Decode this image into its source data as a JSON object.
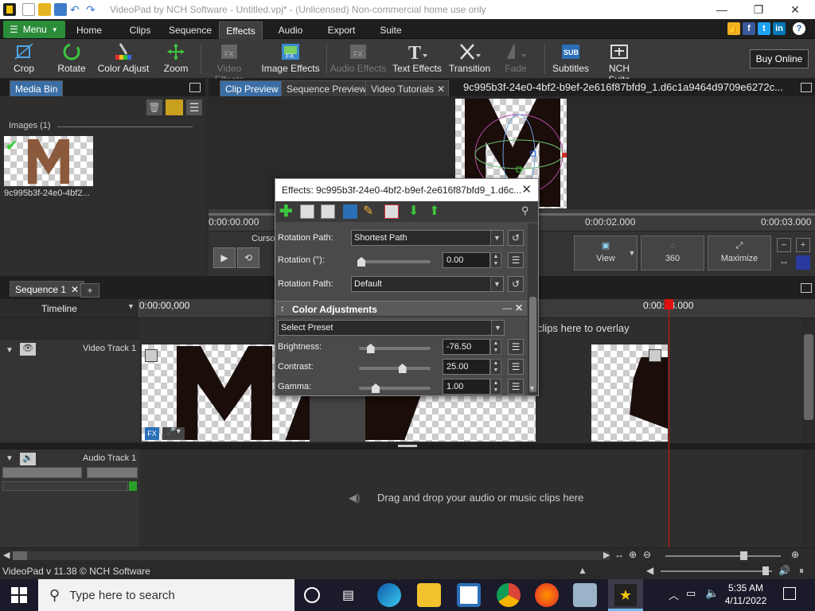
{
  "app": {
    "window_title": "VideoPad by NCH Software - Untitled.vpj* - (Unlicensed) Non-commercial home use only"
  },
  "ribbon": {
    "menu_label": "Menu",
    "tabs": [
      "Home",
      "Clips",
      "Sequence",
      "Effects",
      "Audio",
      "Export",
      "Suite"
    ],
    "active_tab": "Effects"
  },
  "toolbar": {
    "tools": [
      {
        "label": "Crop",
        "icon": "crop-icon",
        "enabled": true
      },
      {
        "label": "Rotate",
        "icon": "rotate-icon",
        "enabled": true
      },
      {
        "label": "Color Adjust",
        "icon": "color-adjust-icon",
        "enabled": true
      },
      {
        "label": "Zoom",
        "icon": "zoom-icon",
        "enabled": true
      },
      {
        "label": "Video Effects",
        "icon": "video-effects-icon",
        "enabled": false
      },
      {
        "label": "Image Effects",
        "icon": "image-effects-icon",
        "enabled": true
      },
      {
        "label": "Audio Effects",
        "icon": "audio-effects-icon",
        "enabled": false
      },
      {
        "label": "Text Effects",
        "icon": "text-effects-icon",
        "enabled": true
      },
      {
        "label": "Transition",
        "icon": "transition-icon",
        "enabled": true
      },
      {
        "label": "Fade",
        "icon": "fade-icon",
        "enabled": false
      },
      {
        "label": "Subtitles",
        "icon": "subtitles-icon",
        "enabled": true
      },
      {
        "label": "NCH Suite",
        "icon": "nch-suite-icon",
        "enabled": true
      }
    ],
    "buy_online": "Buy Online",
    "subtitles_badge": "SUB",
    "fx_badge": "FX"
  },
  "media_bin": {
    "tab": "Media Bin",
    "section": "Images (1)",
    "items": [
      {
        "name": "9c995b3f-24e0-4bf2..."
      }
    ]
  },
  "preview": {
    "tabs": [
      "Clip Preview",
      "Sequence Preview",
      "Video Tutorials"
    ],
    "active_tab": "Clip Preview",
    "clip_name": "9c995b3f-24e0-4bf2-b9ef-2e616f87bfd9_1.d6c1a9464d9709e6272c...",
    "time_start": "0:00:00.000",
    "time_mid": "0:00:02.000",
    "time_end": "0:00:03.000",
    "cursor_label": "Cursor",
    "view_label": "View",
    "badge_360": "360",
    "maximize_label": "Maximize"
  },
  "effects_dialog": {
    "title": "Effects: 9c995b3f-24e0-4bf2-b9ef-2e616f87bfd9_1.d6c...",
    "rows": [
      {
        "label": "Rotation Path:",
        "value": "Shortest Path"
      },
      {
        "label": "Rotation (°):",
        "value": "0.00"
      },
      {
        "label": "Rotation Path:",
        "value": "Default"
      }
    ],
    "section": "Color Adjustments",
    "preset": "Select Preset",
    "adjustments": [
      {
        "label": "Brightness:",
        "value": "-76.50",
        "level": 0.12
      },
      {
        "label": "Contrast:",
        "value": "25.00",
        "level": 0.62
      },
      {
        "label": "Gamma:",
        "value": "1.00",
        "level": 0.2
      }
    ]
  },
  "timeline": {
    "sequence_tab": "Sequence 1",
    "timeline_label": "Timeline",
    "ruler_start": "0:00:00,000",
    "ruler_mark": "0:00:03.000",
    "overlay_hint": "clips here to overlay",
    "video_track": "Video Track 1",
    "audio_track": "Audio Track 1",
    "audio_hint": "Drag and drop your audio or music clips here",
    "fx_badge": "FX"
  },
  "status": {
    "version": "VideoPad v 11.38 © NCH Software"
  },
  "taskbar": {
    "search_placeholder": "Type here to search",
    "time": "5:35 AM",
    "date": "4/11/2022"
  },
  "colors": {
    "accent_green": "#2b8c3a",
    "active_tab_blue": "#3b6ea5",
    "playhead_red": "#e01010"
  }
}
